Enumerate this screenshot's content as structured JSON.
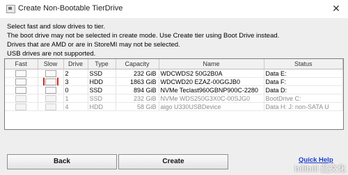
{
  "window": {
    "title": "Create Non-Bootable TierDrive",
    "close_glyph": "✕"
  },
  "instructions": [
    "Select fast and slow drives to tier.",
    "The boot drive may not be selected in create mode. Use Create tier using Boot Drive instead.",
    "Drives that are AMD or are in StoreMI may not be selected.",
    "USB drives are not supported."
  ],
  "table": {
    "headers": [
      "Fast",
      "Slow",
      "Drive",
      "Type",
      "Capacity",
      "Name",
      "Status"
    ],
    "rows": [
      {
        "drive": "2",
        "type": "SSD",
        "capacity": "232 GiB",
        "name": "WDCWDS2 50G2B0A",
        "status": "Data E:",
        "enabled": true
      },
      {
        "drive": "3",
        "type": "HDD",
        "capacity": "1863 GiB",
        "name": "WDCWD20 EZAZ-00GGJB0",
        "status": "Data F:",
        "enabled": true
      },
      {
        "drive": "0",
        "type": "SSD",
        "capacity": "894 GiB",
        "name": "NVMe Teclast960GBNP900C-2280",
        "status": "Data D:",
        "enabled": true
      },
      {
        "drive": "1",
        "type": "SSD",
        "capacity": "232 GiB",
        "name": "NVMe WDS250G3X0C-00SJG0",
        "status": "BootDrive C:",
        "enabled": false
      },
      {
        "drive": "4",
        "type": "HDD",
        "capacity": "58 GiB",
        "name": "aigo U330USBDevice",
        "status": "Data H: J:   non-SATA  U",
        "enabled": false
      }
    ]
  },
  "buttons": {
    "back": "Back",
    "create": "Create"
  },
  "quick_help": "Quick Help",
  "watermark": "bilibili 藏文化"
}
